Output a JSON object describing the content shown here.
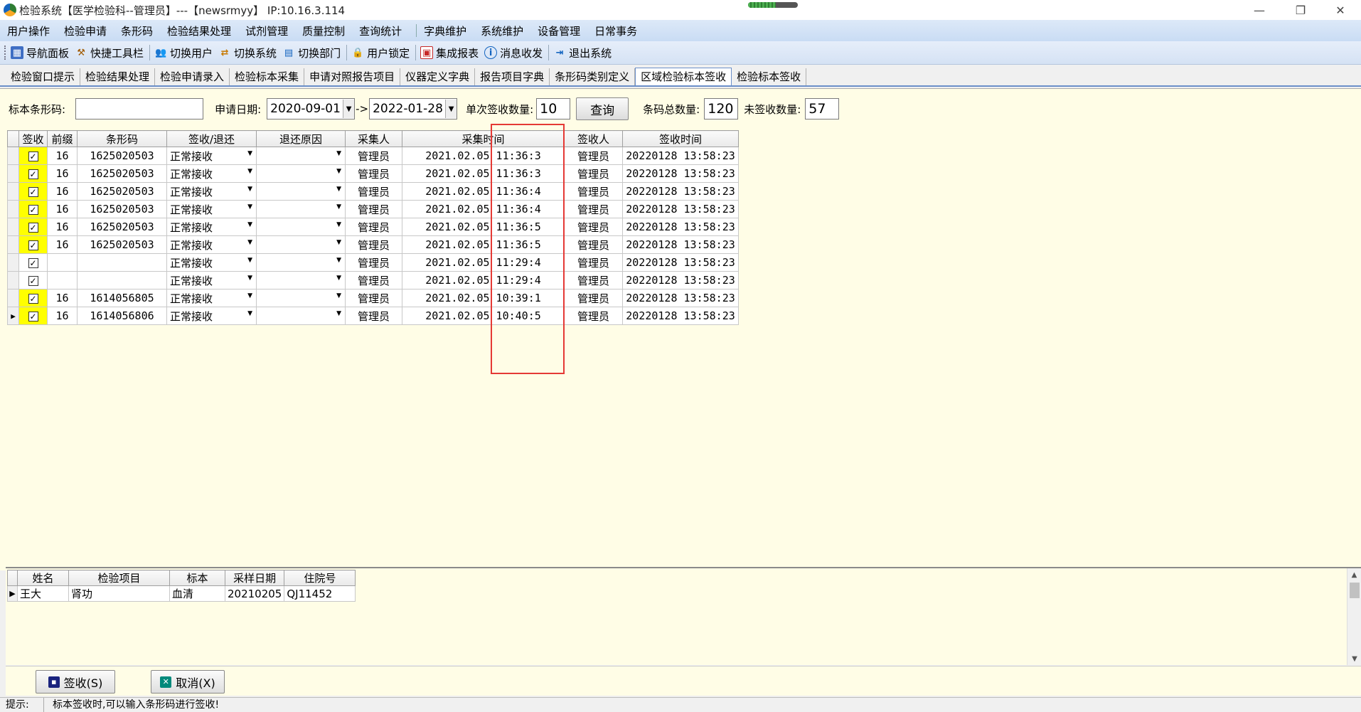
{
  "window": {
    "title": "检验系统【医学检验科--管理员】---【newsrmyy】 IP:10.16.3.114",
    "progress": 0.55
  },
  "menu": [
    "用户操作",
    "检验申请",
    "条形码",
    "检验结果处理",
    "试剂管理",
    "质量控制",
    "查询统计",
    "字典维护",
    "系统维护",
    "设备管理",
    "日常事务"
  ],
  "toolbar": {
    "nav_panel": "导航面板",
    "quick_bar": "快捷工具栏",
    "switch_user": "切换用户",
    "switch_system": "切换系统",
    "switch_dept": "切换部门",
    "user_lock": "用户锁定",
    "integrated_report": "集成报表",
    "messages": "消息收发",
    "exit": "退出系统"
  },
  "tabs": [
    "检验窗口提示",
    "检验结果处理",
    "检验申请录入",
    "检验标本采集",
    "申请对照报告项目",
    "仪器定义字典",
    "报告项目字典",
    "条形码类别定义",
    "区域检验标本签收",
    "检验标本签收"
  ],
  "active_tab": "区域检验标本签收",
  "filter": {
    "barcode_label": "标本条形码:",
    "barcode_value": "",
    "date_label": "申请日期:",
    "date_from": "2020-09-01",
    "date_to": "2022-01-28",
    "arrow": "->",
    "single_qty_label": "单次签收数量:",
    "single_qty": "10",
    "query_button": "查询",
    "total_label": "条码总数量:",
    "total": "120",
    "unsigned_label": "未签收数量:",
    "unsigned": "57"
  },
  "main_table": {
    "columns": [
      "签收",
      "前缀",
      "条形码",
      "签收/退还",
      "退还原因",
      "采集人",
      "采集时间",
      "签收人",
      "签收时间"
    ],
    "rows": [
      {
        "checked": true,
        "hl": true,
        "prefix": "16",
        "barcode": "1625020503",
        "status": "正常接收",
        "reason": "",
        "collector": "管理员",
        "collect_time": "2021.02.05 11:36:3",
        "receiver": "管理员",
        "receive_time": "20220128 13:58:23"
      },
      {
        "checked": true,
        "hl": true,
        "prefix": "16",
        "barcode": "1625020503",
        "status": "正常接收",
        "reason": "",
        "collector": "管理员",
        "collect_time": "2021.02.05 11:36:3",
        "receiver": "管理员",
        "receive_time": "20220128 13:58:23"
      },
      {
        "checked": true,
        "hl": true,
        "prefix": "16",
        "barcode": "1625020503",
        "status": "正常接收",
        "reason": "",
        "collector": "管理员",
        "collect_time": "2021.02.05 11:36:4",
        "receiver": "管理员",
        "receive_time": "20220128 13:58:23"
      },
      {
        "checked": true,
        "hl": true,
        "prefix": "16",
        "barcode": "1625020503",
        "status": "正常接收",
        "reason": "",
        "collector": "管理员",
        "collect_time": "2021.02.05 11:36:4",
        "receiver": "管理员",
        "receive_time": "20220128 13:58:23"
      },
      {
        "checked": true,
        "hl": true,
        "prefix": "16",
        "barcode": "1625020503",
        "status": "正常接收",
        "reason": "",
        "collector": "管理员",
        "collect_time": "2021.02.05 11:36:5",
        "receiver": "管理员",
        "receive_time": "20220128 13:58:23"
      },
      {
        "checked": true,
        "hl": true,
        "prefix": "16",
        "barcode": "1625020503",
        "status": "正常接收",
        "reason": "",
        "collector": "管理员",
        "collect_time": "2021.02.05 11:36:5",
        "receiver": "管理员",
        "receive_time": "20220128 13:58:23"
      },
      {
        "checked": true,
        "hl": false,
        "prefix": "",
        "barcode": "",
        "status": "正常接收",
        "reason": "",
        "collector": "管理员",
        "collect_time": "2021.02.05 11:29:4",
        "receiver": "管理员",
        "receive_time": "20220128 13:58:23"
      },
      {
        "checked": true,
        "hl": false,
        "prefix": "",
        "barcode": "",
        "status": "正常接收",
        "reason": "",
        "collector": "管理员",
        "collect_time": "2021.02.05 11:29:4",
        "receiver": "管理员",
        "receive_time": "20220128 13:58:23"
      },
      {
        "checked": true,
        "hl": true,
        "prefix": "16",
        "barcode": "1614056805",
        "status": "正常接收",
        "reason": "",
        "collector": "管理员",
        "collect_time": "2021.02.05 10:39:1",
        "receiver": "管理员",
        "receive_time": "20220128 13:58:23"
      },
      {
        "checked": true,
        "hl": true,
        "prefix": "16",
        "barcode": "1614056806",
        "status": "正常接收",
        "reason": "",
        "collector": "管理员",
        "collect_time": "2021.02.05 10:40:5",
        "receiver": "管理员",
        "receive_time": "20220128 13:58:23",
        "current": true
      }
    ]
  },
  "detail_table": {
    "columns": [
      "姓名",
      "检验项目",
      "标本",
      "采样日期",
      "住院号"
    ],
    "rows": [
      {
        "name": "王大",
        "item": "肾功",
        "specimen": "血清",
        "date": "20210205",
        "inpatient_no": "QJ11452"
      }
    ]
  },
  "actions": {
    "sign_button": "签收(S)",
    "cancel_button": "取消(X)"
  },
  "status": {
    "label": "提示:",
    "hint": "标本签收时,可以输入条形码进行签收!"
  },
  "colors": {
    "highlight": "#ffff00",
    "annotation_red": "#e53935",
    "panel_bg": "#fffde6",
    "menu_bg": "#c9dcf4"
  }
}
